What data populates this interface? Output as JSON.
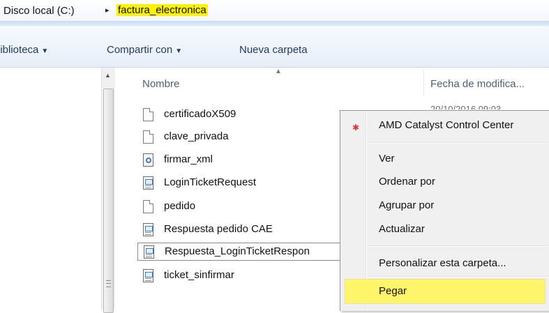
{
  "address": {
    "crumb_root": "Disco local (C:)",
    "crumb_arrow": "▸",
    "crumb_current": "factura_electronica"
  },
  "toolbar": {
    "library_label": "biblioteca",
    "share_label": "Compartir con",
    "new_folder_label": "Nueva carpeta",
    "caret": "▼"
  },
  "columns": {
    "name": "Nombre",
    "date": "Fecha de modifica...",
    "date_peek": "20/10/2016 09:03"
  },
  "files": [
    {
      "name": "certificadoX509",
      "icon": "document-icon"
    },
    {
      "name": "clave_privada",
      "icon": "document-icon"
    },
    {
      "name": "firmar_xml",
      "icon": "config-file-icon"
    },
    {
      "name": "LoginTicketRequest",
      "icon": "xml-file-icon"
    },
    {
      "name": "pedido",
      "icon": "document-icon"
    },
    {
      "name": "Respuesta pedido CAE",
      "icon": "xml-file-icon"
    },
    {
      "name": "Respuesta_LoginTicketRespon",
      "icon": "xml-file-icon"
    },
    {
      "name": "ticket_sinfirmar",
      "icon": "xml-file-icon"
    }
  ],
  "context_menu": {
    "amd": "AMD Catalyst Control Center",
    "view": "Ver",
    "sort": "Ordenar por",
    "group": "Agrupar por",
    "refresh": "Actualizar",
    "customize": "Personalizar esta carpeta...",
    "paste": "Pegar"
  },
  "colors": {
    "highlight": "#fff56a",
    "address_highlight": "#fff200"
  }
}
